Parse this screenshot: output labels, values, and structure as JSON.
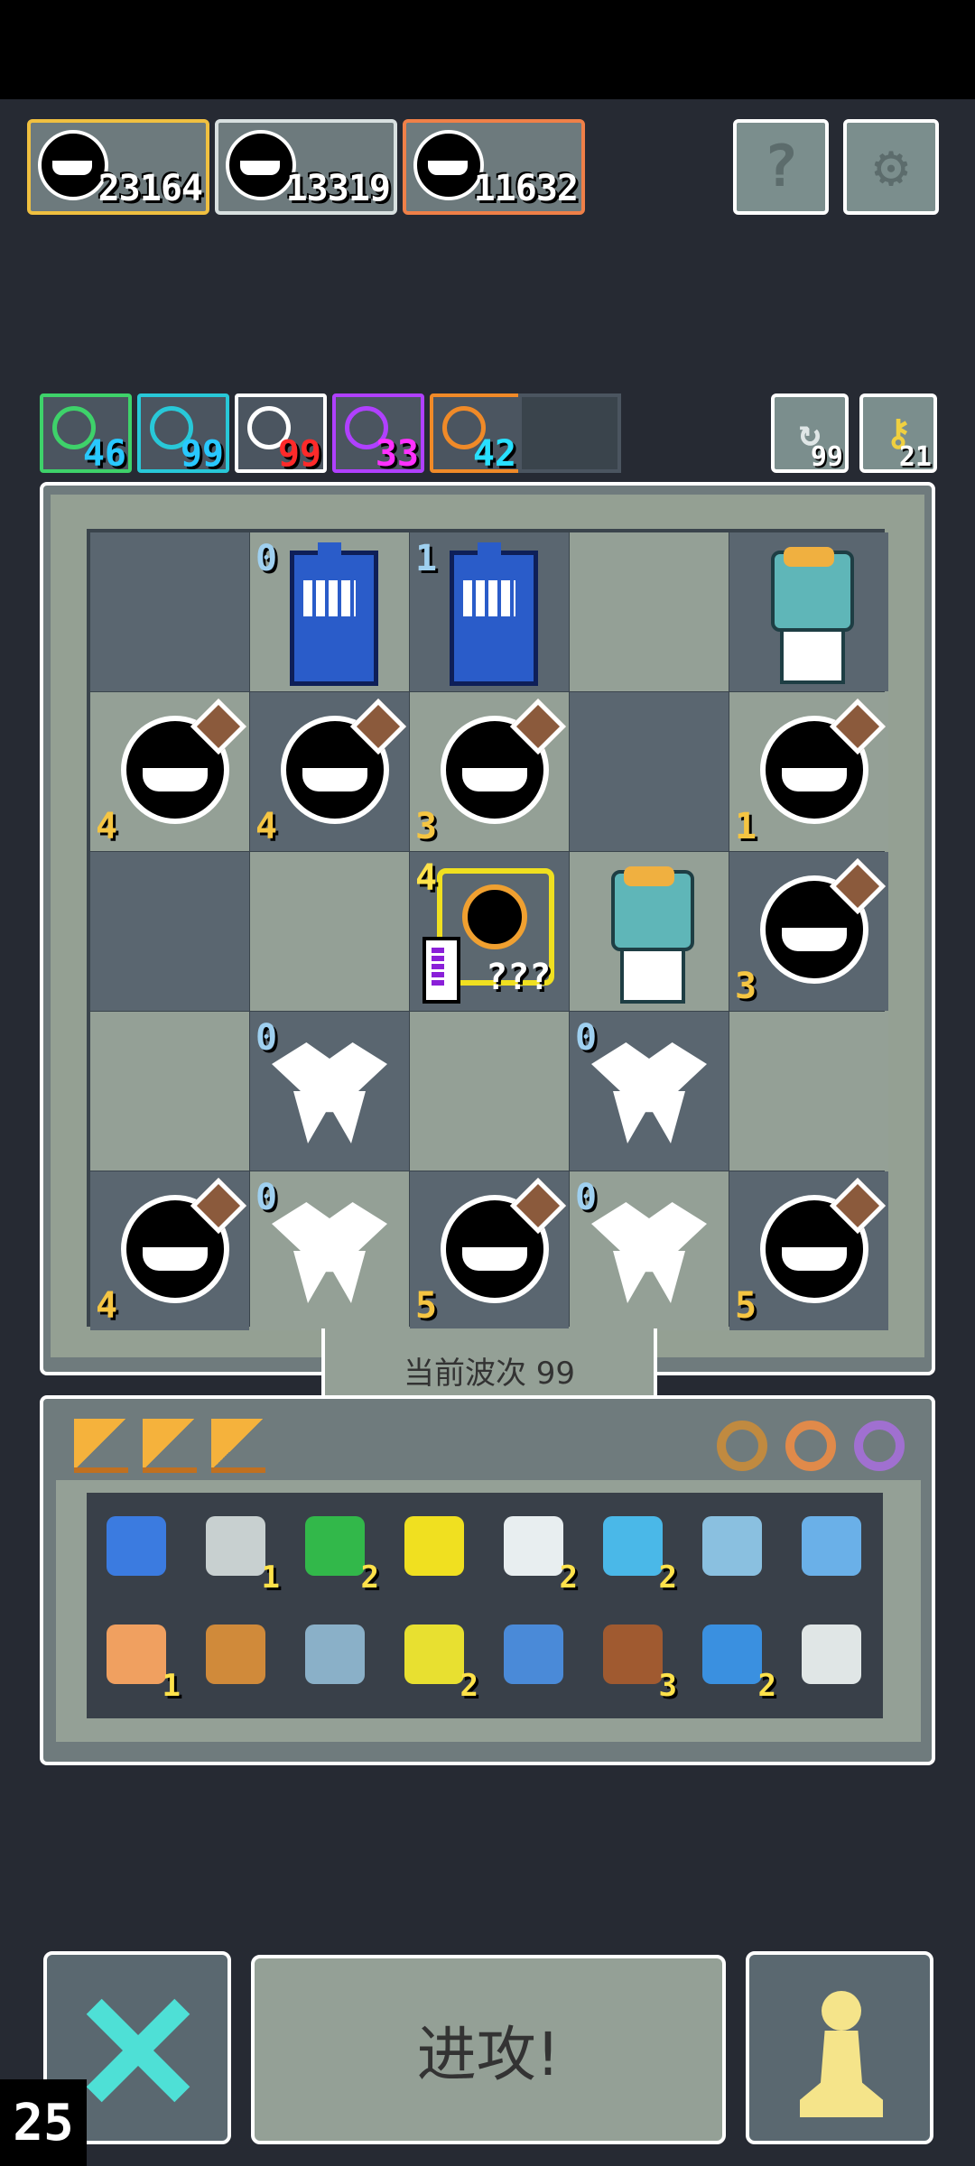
{
  "scores": [
    "23164",
    "13319",
    "11632"
  ],
  "score_colors": [
    "#f0c040",
    "#d8e0e0",
    "#f08048"
  ],
  "top_buttons": {
    "help": "?",
    "settings": "gear-icon"
  },
  "resources": [
    {
      "color": "#3ed26a",
      "value": "46",
      "text_color": "#28c8ff"
    },
    {
      "color": "#28c8d8",
      "value": "99",
      "text_color": "#28c8ff"
    },
    {
      "color": "#ffffff",
      "value": "99",
      "text_color": "#ff2a2a"
    },
    {
      "color": "#b040ff",
      "value": "33",
      "text_color": "#ff30ff"
    },
    {
      "color": "#f08a28",
      "value": "42",
      "text_color": "#28e0ff"
    }
  ],
  "side_counters": {
    "reroll": "99",
    "key": "21"
  },
  "board": [
    [
      {
        "type": "empty"
      },
      {
        "type": "booth",
        "level": "0"
      },
      {
        "type": "booth",
        "level": "1"
      },
      {
        "type": "empty"
      },
      {
        "type": "goblin"
      }
    ],
    [
      {
        "type": "bottle",
        "level": "4"
      },
      {
        "type": "bottle",
        "level": "4"
      },
      {
        "type": "bottle",
        "level": "3"
      },
      {
        "type": "empty"
      },
      {
        "type": "bottle",
        "level": "1"
      }
    ],
    [
      {
        "type": "empty"
      },
      {
        "type": "empty"
      },
      {
        "type": "special",
        "level": "4",
        "tag": "???"
      },
      {
        "type": "goblin"
      },
      {
        "type": "bottle",
        "level": "3"
      }
    ],
    [
      {
        "type": "empty"
      },
      {
        "type": "moth",
        "level": "0"
      },
      {
        "type": "empty"
      },
      {
        "type": "moth",
        "level": "0"
      },
      {
        "type": "empty"
      }
    ],
    [
      {
        "type": "bottle",
        "level": "4"
      },
      {
        "type": "moth",
        "level": "0"
      },
      {
        "type": "bottle",
        "level": "5"
      },
      {
        "type": "moth",
        "level": "0"
      },
      {
        "type": "bottle",
        "level": "5"
      }
    ]
  ],
  "wave_label": "当前波次 99",
  "inventory": {
    "row1": [
      {
        "icon": "blue-gem-bag-icon",
        "color": "#3b7be0",
        "count": ""
      },
      {
        "icon": "scroll-icon",
        "color": "#c8d0d0",
        "count": "1"
      },
      {
        "icon": "green-gem-icon",
        "color": "#32b84a",
        "count": "2"
      },
      {
        "icon": "potion-flask-icon",
        "color": "#f0e020",
        "count": ""
      },
      {
        "icon": "cloud-icon",
        "color": "#e8eef0",
        "count": "2"
      },
      {
        "icon": "blue-cross-icon",
        "color": "#4ab8e8",
        "count": "2"
      },
      {
        "icon": "bottle-icon",
        "color": "#8ac0e0",
        "count": ""
      },
      {
        "icon": "blue-nodes-icon",
        "color": "#6ab0e8",
        "count": ""
      }
    ],
    "row2": [
      {
        "icon": "orange-token-icon",
        "color": "#f0a060",
        "count": "1"
      },
      {
        "icon": "star-wand-icon",
        "color": "#d08a3a",
        "count": ""
      },
      {
        "icon": "blue-machine-icon",
        "color": "#8ab0c8",
        "count": ""
      },
      {
        "icon": "chip-icon",
        "color": "#e8e030",
        "count": "2"
      },
      {
        "icon": "blue-device-icon",
        "color": "#4a8ad8",
        "count": ""
      },
      {
        "icon": "book-icon",
        "color": "#a05a30",
        "count": "3"
      },
      {
        "icon": "water-drop-icon",
        "color": "#3a90e0",
        "count": "2"
      },
      {
        "icon": "eye-device-icon",
        "color": "#e0e6e6",
        "count": ""
      }
    ]
  },
  "rings": [
    "#c08a40",
    "#e08a4a",
    "#a070d0"
  ],
  "controls": {
    "attack": "进攻!"
  },
  "fps": "25"
}
